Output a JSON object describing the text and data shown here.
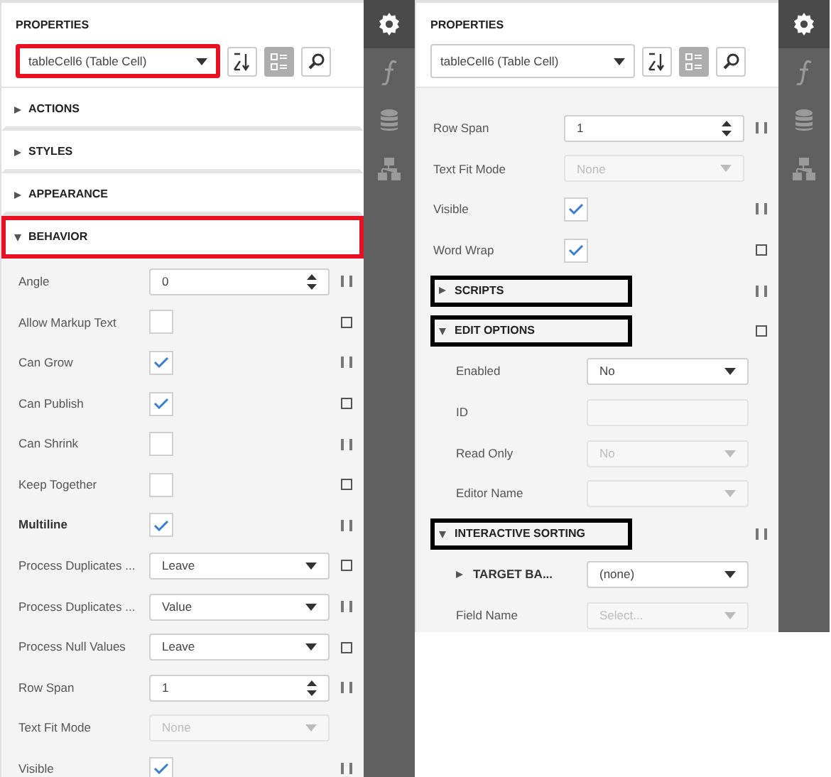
{
  "panels": [
    {
      "title": "PROPERTIES",
      "selector": "tableCell6 (Table Cell)",
      "selector_annotated": true,
      "toolbar": [
        {
          "kind": "sort",
          "selected": false
        },
        {
          "kind": "categories",
          "selected": true
        },
        {
          "kind": "search",
          "selected": false
        }
      ],
      "sidebar": [
        {
          "kind": "gear",
          "selected": true
        },
        {
          "kind": "function",
          "selected": false
        },
        {
          "kind": "database",
          "selected": false
        },
        {
          "kind": "tree",
          "selected": false
        }
      ],
      "items": [
        {
          "kind": "category",
          "label": "ACTIONS",
          "expanded": false
        },
        {
          "kind": "category",
          "label": "STYLES",
          "expanded": false
        },
        {
          "kind": "category",
          "label": "APPEARANCE",
          "expanded": false
        },
        {
          "kind": "category",
          "label": "BEHAVIOR",
          "expanded": true,
          "color": "#e81123",
          "children": [
            {
              "kind": "spin",
              "label": "Angle",
              "value": "0",
              "modified": true
            },
            {
              "kind": "checkbox",
              "label": "Allow Markup Text",
              "checked": false,
              "modified": false
            },
            {
              "kind": "checkbox",
              "label": "Can Grow",
              "checked": true,
              "modified": true
            },
            {
              "kind": "checkbox",
              "label": "Can Publish",
              "checked": true,
              "modified": false
            },
            {
              "kind": "checkbox",
              "label": "Can Shrink",
              "checked": false,
              "modified": true
            },
            {
              "kind": "checkbox",
              "label": "Keep Together",
              "checked": false,
              "modified": false
            },
            {
              "kind": "checkbox",
              "label": "Multiline",
              "checked": true,
              "modified": true,
              "bold": true
            },
            {
              "kind": "dropdown",
              "label": "Process Duplicates ...",
              "value": "Leave",
              "disabled": false,
              "modified": false
            },
            {
              "kind": "dropdown",
              "label": "Process Duplicates ...",
              "value": "Value",
              "disabled": false,
              "modified": true
            },
            {
              "kind": "dropdown",
              "label": "Process Null Values",
              "value": "Leave",
              "disabled": false,
              "modified": false
            },
            {
              "kind": "spin",
              "label": "Row Span",
              "value": "1",
              "modified": true
            },
            {
              "kind": "dropdown",
              "label": "Text Fit Mode",
              "value": "None",
              "disabled": true
            },
            {
              "kind": "checkbox",
              "label": "Visible",
              "checked": true,
              "modified": true
            }
          ]
        }
      ]
    },
    {
      "title": "PROPERTIES",
      "selector": "tableCell6 (Table Cell)",
      "selector_annotated": false,
      "toolbar": [
        {
          "kind": "sort",
          "selected": false
        },
        {
          "kind": "categories",
          "selected": true
        },
        {
          "kind": "search",
          "selected": false
        }
      ],
      "sidebar": [
        {
          "kind": "gear",
          "selected": true
        },
        {
          "kind": "function",
          "selected": false
        },
        {
          "kind": "database",
          "selected": false
        },
        {
          "kind": "tree",
          "selected": false
        }
      ],
      "items": [
        {
          "kind": "spin",
          "label": "Row Span",
          "value": "1",
          "modified": true
        },
        {
          "kind": "dropdown",
          "label": "Text Fit Mode",
          "value": "None",
          "disabled": true
        },
        {
          "kind": "checkbox",
          "label": "Visible",
          "checked": true,
          "modified": true
        },
        {
          "kind": "checkbox",
          "label": "Word Wrap",
          "checked": true,
          "modified": false
        },
        {
          "kind": "group",
          "label": "SCRIPTS",
          "expanded": false,
          "color": "#000000",
          "modified": true
        },
        {
          "kind": "group",
          "label": "EDIT OPTIONS",
          "expanded": true,
          "color": "#000000",
          "modified": false,
          "children": [
            {
              "kind": "dropdown",
              "label": "Enabled",
              "value": "No",
              "disabled": false
            },
            {
              "kind": "text",
              "label": "ID",
              "disabled": true
            },
            {
              "kind": "dropdown",
              "label": "Read Only",
              "value": "No",
              "disabled": true
            },
            {
              "kind": "dropdown",
              "label": "Editor Name",
              "disabled": true
            }
          ]
        },
        {
          "kind": "group",
          "label": "INTERACTIVE SORTING",
          "expanded": true,
          "color": "#000000",
          "modified": true,
          "children": [
            {
              "kind": "dropdown",
              "label": "TARGET BA...",
              "value": "(none)",
              "disabled": false,
              "expandable": true
            },
            {
              "kind": "dropdown",
              "label": "Field Name",
              "placeholder": "Select...",
              "disabled": true
            }
          ]
        }
      ]
    }
  ]
}
